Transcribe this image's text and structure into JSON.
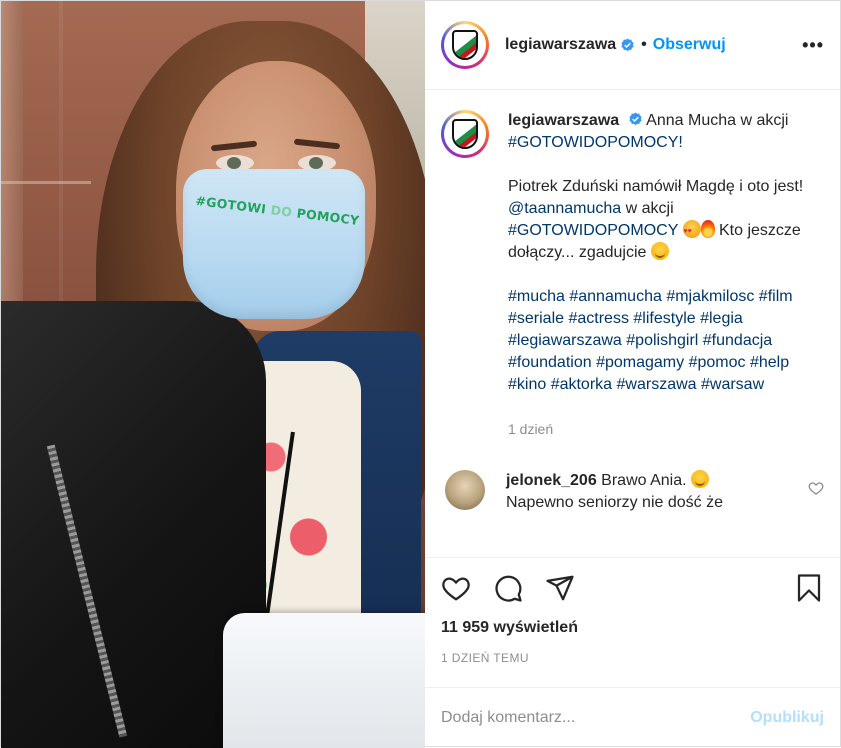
{
  "media": {
    "mask_text_left": "#GOTOWI",
    "mask_text_right": "POMOCY"
  },
  "header": {
    "username": "legiawarszawa",
    "dot": "•",
    "follow_label": "Obserwuj",
    "more_label": "•••"
  },
  "caption": {
    "username": "legiawarszawa",
    "line1_text": "Anna Mucha w akcji",
    "line1_tag": "#GOTOWIDOPOMOCY!",
    "para2_text": "Piotrek Zduński namówił Magdę i oto jest!",
    "mention": "@taannamucha",
    "para3_text": "w akcji",
    "para3_tag": "#GOTOWIDOPOMOCY",
    "para3_tail": "Kto jeszcze dołączy... zgadujcie",
    "hashtags": [
      "#mucha",
      "#annamucha",
      "#mjakmilosc",
      "#film",
      "#seriale",
      "#actress",
      "#lifestyle",
      "#legia",
      "#legiawarszawa",
      "#polishgirl",
      "#fundacja",
      "#foundation",
      "#pomagamy",
      "#pomoc",
      "#help",
      "#kino",
      "#aktorka",
      "#warszawa",
      "#warsaw"
    ],
    "time": "1 dzień"
  },
  "comment": {
    "username": "jelonek_206",
    "text": "Brawo Ania.",
    "text2": "Napewno seniorzy nie dość że"
  },
  "stats": {
    "views_count": "11 959",
    "views_label": "wyświetleń",
    "date": "1 DZIEŃ TEMU"
  },
  "add_comment": {
    "placeholder": "Dodaj komentarz...",
    "publish_label": "Opublikuj"
  },
  "colors": {
    "accent": "#0095f6",
    "hashtag": "#00376b",
    "muted": "#8e8e8e",
    "publish_disabled": "#b2dffc"
  },
  "icons": [
    "heart-icon",
    "comment-icon",
    "share-icon",
    "bookmark-icon",
    "verified-icon",
    "more-icon"
  ]
}
